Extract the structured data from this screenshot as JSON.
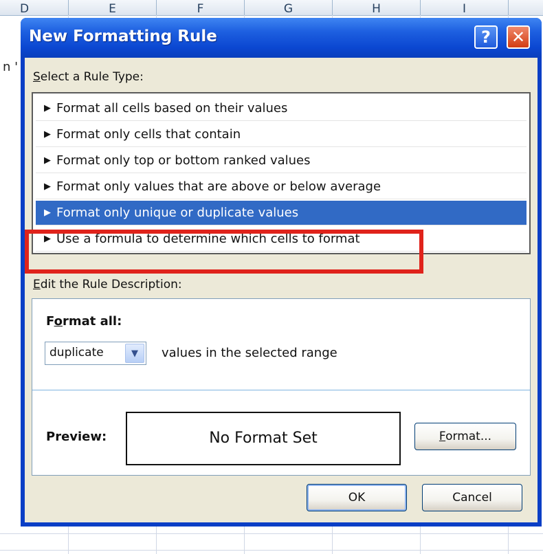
{
  "spreadsheet": {
    "column_headers": [
      "D",
      "E",
      "F",
      "G",
      "H",
      "I"
    ],
    "row_fragment": "n '"
  },
  "dialog": {
    "title": "New Formatting Rule",
    "help_button": "?",
    "close_button": "✕",
    "rule_type_section": {
      "label_prefix": "",
      "label_accel": "S",
      "label_rest": "elect a Rule Type:",
      "items": [
        {
          "label": "Format all cells based on their values",
          "selected": false
        },
        {
          "label": "Format only cells that contain",
          "selected": false
        },
        {
          "label": "Format only top or bottom ranked values",
          "selected": false
        },
        {
          "label": "Format only values that are above or below average",
          "selected": false
        },
        {
          "label": "Format only unique or duplicate values",
          "selected": true
        },
        {
          "label": "Use a formula to determine which cells to format",
          "selected": false
        }
      ],
      "arrow": "▶"
    },
    "description_section": {
      "label_accel": "E",
      "label_rest": "dit the Rule Description:",
      "format_all_prefix": "F",
      "format_all_accel": "o",
      "format_all_rest": "rmat all:",
      "combo_value": "duplicate",
      "combo_arrow": "▼",
      "combo_suffix": "values in the selected range",
      "preview_label": "Preview:",
      "preview_text": "No Format Set",
      "format_button_accel": "F",
      "format_button_rest": "ormat..."
    },
    "ok_label": "OK",
    "cancel_label": "Cancel",
    "highlight_color": "#e0231b",
    "selection_color": "#316ac5"
  }
}
